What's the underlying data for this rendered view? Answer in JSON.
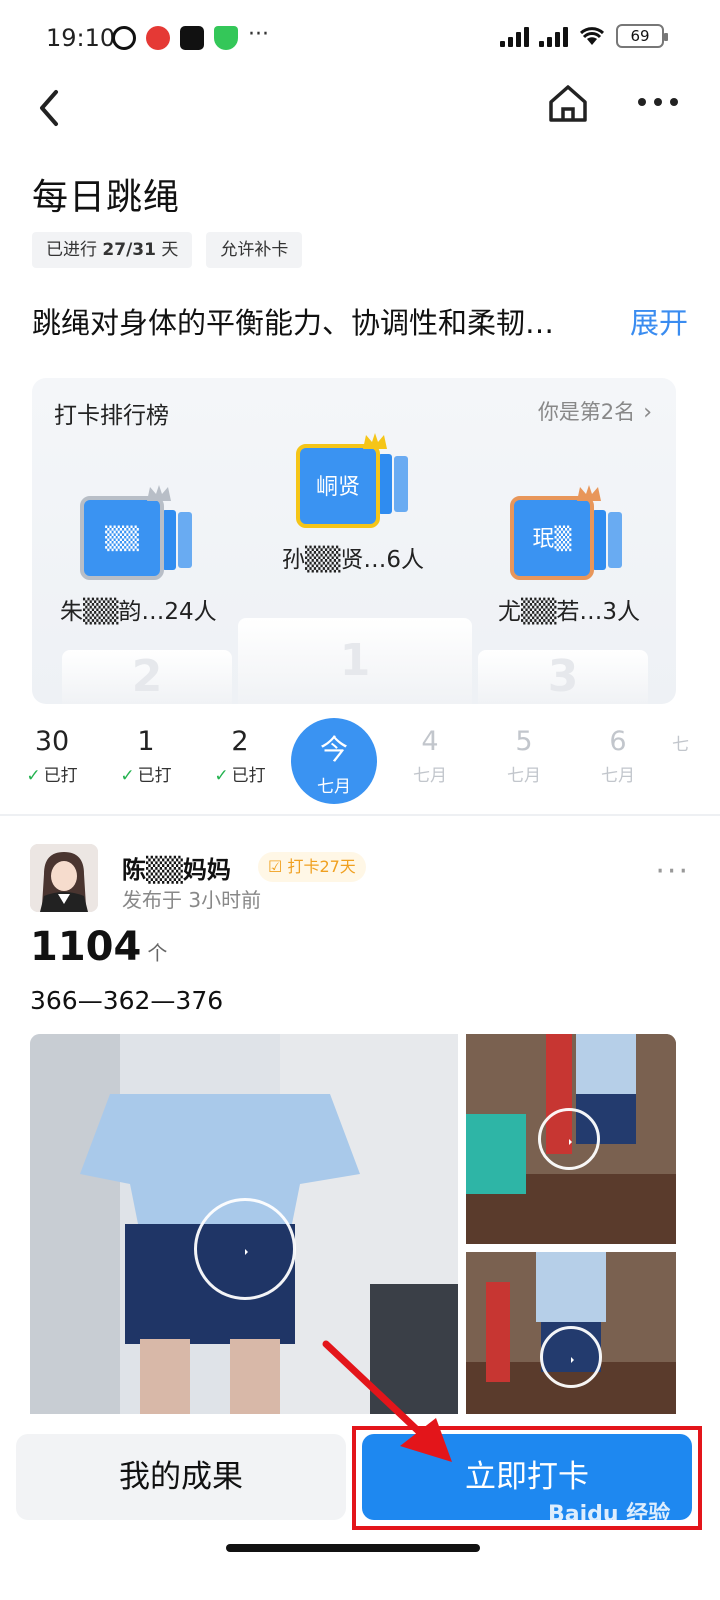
{
  "status": {
    "time": "19:10",
    "battery": "69"
  },
  "header": {
    "title": "每日跳绳",
    "tag_progress_prefix": "已进行",
    "tag_progress_value": "27/31",
    "tag_progress_suffix": "天",
    "tag_makeup": "允许补卡",
    "description": "跳绳对身体的平衡能力、协调性和柔韧…",
    "expand": "展开"
  },
  "ranking": {
    "title": "打卡排行榜",
    "my_rank": "你是第2名",
    "first": {
      "avatar_text": "峒贤",
      "name": "孙▒▒贤…6人",
      "podium": "1"
    },
    "second": {
      "avatar_text": "▒▒",
      "name": "朱▒▒韵…24人",
      "podium": "2"
    },
    "third": {
      "avatar_text": "珉▒",
      "name": "尤▒▒若…3人",
      "podium": "3"
    }
  },
  "dates": [
    {
      "num": "30",
      "sub": "已打",
      "done": true
    },
    {
      "num": "1",
      "sub": "已打",
      "done": true
    },
    {
      "num": "2",
      "sub": "已打",
      "done": true
    },
    {
      "num": "今",
      "sub": "七月",
      "today": true
    },
    {
      "num": "4",
      "sub": "七月"
    },
    {
      "num": "5",
      "sub": "七月"
    },
    {
      "num": "6",
      "sub": "七月"
    },
    {
      "num": "",
      "sub": "七"
    }
  ],
  "post": {
    "user": "陈▒▒妈妈",
    "badge": "打卡27天",
    "time": "发布于 3小时前",
    "count": "1104",
    "count_unit": "个",
    "text": "366—362—376"
  },
  "footer": {
    "my_results": "我的成果",
    "check_in_now": "立即打卡"
  },
  "watermark": "Baidu 经验"
}
